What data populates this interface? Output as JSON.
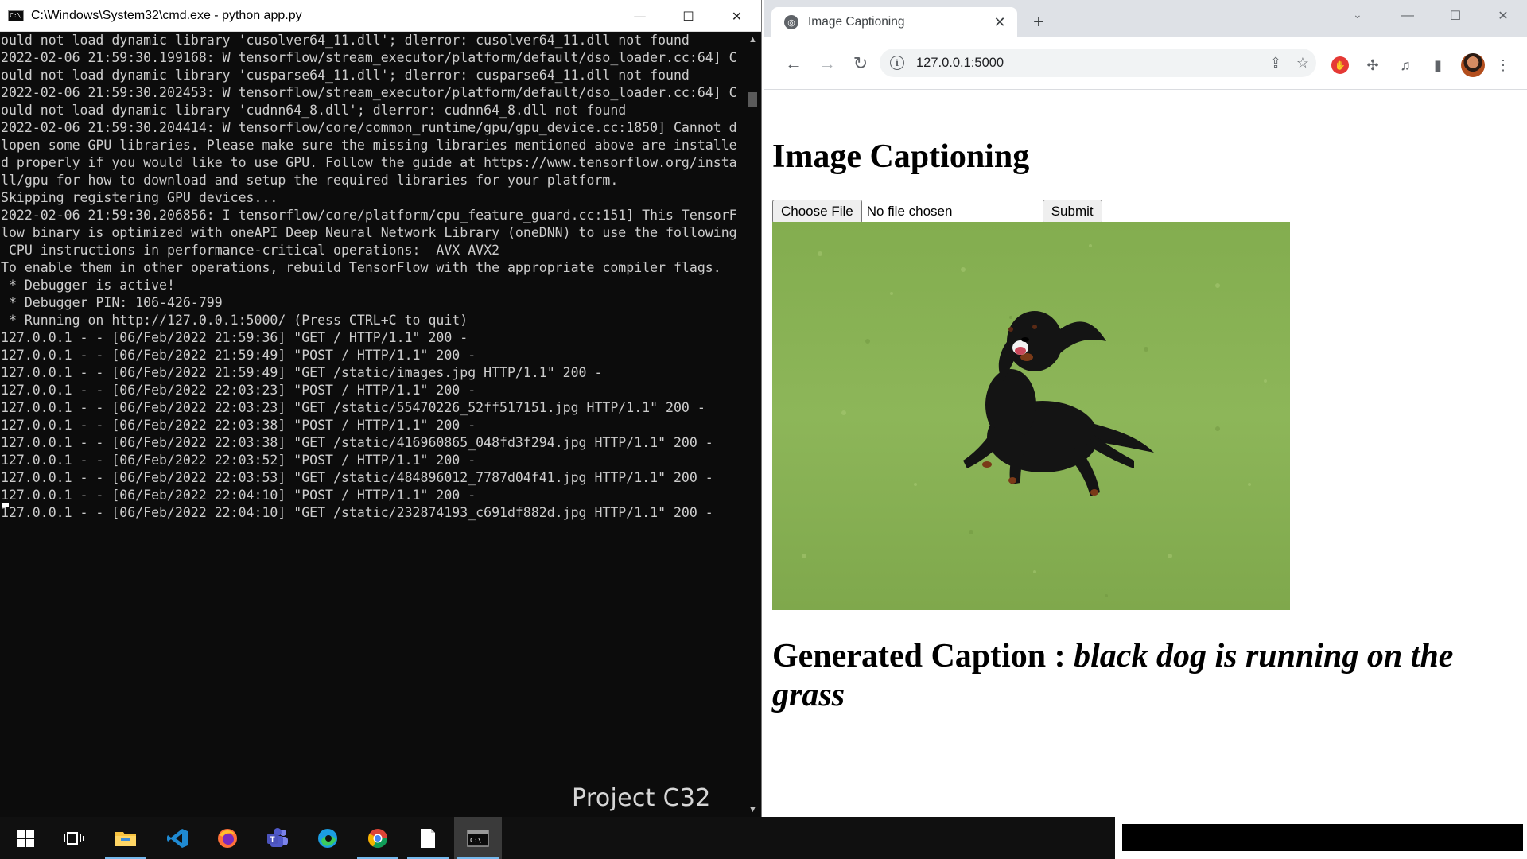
{
  "cmd": {
    "title": "C:\\Windows\\System32\\cmd.exe - python  app.py",
    "lines": [
      "ould not load dynamic library 'cusolver64_11.dll'; dlerror: cusolver64_11.dll not found",
      "2022-02-06 21:59:30.199168: W tensorflow/stream_executor/platform/default/dso_loader.cc:64] C",
      "ould not load dynamic library 'cusparse64_11.dll'; dlerror: cusparse64_11.dll not found",
      "2022-02-06 21:59:30.202453: W tensorflow/stream_executor/platform/default/dso_loader.cc:64] C",
      "ould not load dynamic library 'cudnn64_8.dll'; dlerror: cudnn64_8.dll not found",
      "2022-02-06 21:59:30.204414: W tensorflow/core/common_runtime/gpu/gpu_device.cc:1850] Cannot d",
      "lopen some GPU libraries. Please make sure the missing libraries mentioned above are installe",
      "d properly if you would like to use GPU. Follow the guide at https://www.tensorflow.org/insta",
      "ll/gpu for how to download and setup the required libraries for your platform.",
      "Skipping registering GPU devices...",
      "2022-02-06 21:59:30.206856: I tensorflow/core/platform/cpu_feature_guard.cc:151] This TensorF",
      "low binary is optimized with oneAPI Deep Neural Network Library (oneDNN) to use the following",
      " CPU instructions in performance-critical operations:  AVX AVX2",
      "To enable them in other operations, rebuild TensorFlow with the appropriate compiler flags.",
      " * Debugger is active!",
      " * Debugger PIN: 106-426-799",
      " * Running on http://127.0.0.1:5000/ (Press CTRL+C to quit)",
      "127.0.0.1 - - [06/Feb/2022 21:59:36] \"GET / HTTP/1.1\" 200 -",
      "127.0.0.1 - - [06/Feb/2022 21:59:49] \"POST / HTTP/1.1\" 200 -",
      "127.0.0.1 - - [06/Feb/2022 21:59:49] \"GET /static/images.jpg HTTP/1.1\" 200 -",
      "127.0.0.1 - - [06/Feb/2022 22:03:23] \"POST / HTTP/1.1\" 200 -",
      "127.0.0.1 - - [06/Feb/2022 22:03:23] \"GET /static/55470226_52ff517151.jpg HTTP/1.1\" 200 -",
      "127.0.0.1 - - [06/Feb/2022 22:03:38] \"POST / HTTP/1.1\" 200 -",
      "127.0.0.1 - - [06/Feb/2022 22:03:38] \"GET /static/416960865_048fd3f294.jpg HTTP/1.1\" 200 -",
      "127.0.0.1 - - [06/Feb/2022 22:03:52] \"POST / HTTP/1.1\" 200 -",
      "127.0.0.1 - - [06/Feb/2022 22:03:53] \"GET /static/484896012_7787d04f41.jpg HTTP/1.1\" 200 -",
      "127.0.0.1 - - [06/Feb/2022 22:04:10] \"POST / HTTP/1.1\" 200 -",
      "127.0.0.1 - - [06/Feb/2022 22:04:10] \"GET /static/232874193_c691df882d.jpg HTTP/1.1\" 200 -"
    ],
    "watermark": "Project C32",
    "controls": {
      "minimize": "—",
      "maximize": "☐",
      "close": "✕"
    }
  },
  "browser": {
    "tab_title": "Image Captioning",
    "tab_close": "✕",
    "new_tab": "+",
    "url": "127.0.0.1:5000",
    "page": {
      "heading": "Image Captioning",
      "choose_file_label": "Choose File",
      "file_status": "No file chosen",
      "submit_label": "Submit",
      "caption_prefix": "Generated Caption : ",
      "caption_text": "black dog is running on the grass"
    }
  },
  "taskbar": {
    "apps": [
      "start-icon",
      "task-view-icon",
      "file-explorer-icon",
      "vscode-icon",
      "firefox-icon",
      "teams-icon",
      "edge-icon",
      "chrome-icon",
      "notepad-icon",
      "terminal-icon"
    ]
  }
}
